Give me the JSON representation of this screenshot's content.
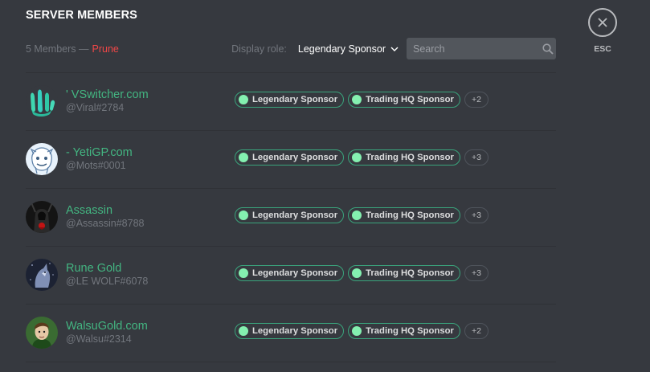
{
  "header": {
    "title": "SERVER MEMBERS"
  },
  "toolbar": {
    "member_count": "5 Members —",
    "prune_label": "Prune",
    "display_role_label": "Display role:",
    "display_role_value": "Legendary Sponsor",
    "search_placeholder": "Search"
  },
  "close": {
    "esc_label": "ESC"
  },
  "members": [
    {
      "nickname": "' VSwitcher.com",
      "username": "@Viral#2784",
      "roles": [
        "Legendary Sponsor",
        "Trading HQ Sponsor"
      ],
      "more": "+2"
    },
    {
      "nickname": "- YetiGP.com",
      "username": "@Mots#0001",
      "roles": [
        "Legendary Sponsor",
        "Trading HQ Sponsor"
      ],
      "more": "+3"
    },
    {
      "nickname": "Assassin",
      "username": "@Assassin#8788",
      "roles": [
        "Legendary Sponsor",
        "Trading HQ Sponsor"
      ],
      "more": "+3"
    },
    {
      "nickname": "Rune Gold",
      "username": "@LE WOLF#6078",
      "roles": [
        "Legendary Sponsor",
        "Trading HQ Sponsor"
      ],
      "more": "+3"
    },
    {
      "nickname": "WalsuGold.com",
      "username": "@Walsu#2314",
      "roles": [
        "Legendary Sponsor",
        "Trading HQ Sponsor"
      ],
      "more": "+2"
    }
  ],
  "colors": {
    "background": "#36393f",
    "nickname": "#43b581",
    "prune": "#f04747",
    "role_dot": "#84f0b0"
  }
}
